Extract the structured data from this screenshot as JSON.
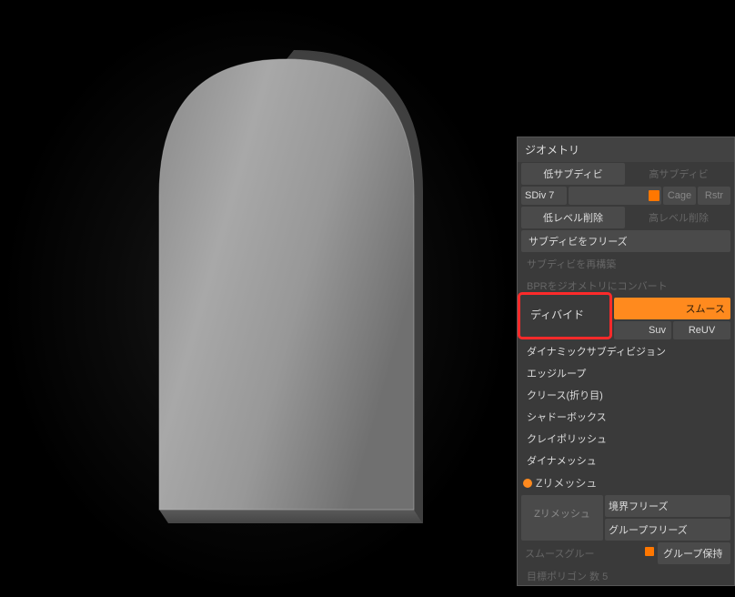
{
  "panel": {
    "title": "ジオメトリ",
    "low_subdiv": "低サブディビ",
    "high_subdiv": "高サブディビ",
    "sdiv_label": "SDiv 7",
    "cage": "Cage",
    "rstr": "Rstr",
    "del_low": "低レベル削除",
    "del_high": "高レベル削除",
    "freeze_subdiv": "サブディビをフリーズ",
    "reconstruct_subdiv": "サブディビを再構築",
    "bpr_convert": "BPRをジオメトリにコンバート",
    "divide": "ディバイド",
    "smooth": "スムース",
    "suv": "Suv",
    "reuv": "ReUV",
    "dynamic_subdiv": "ダイナミックサブディビジョン",
    "edgeloop": "エッジループ",
    "crease": "クリース(折り目)",
    "shadowbox": "シャドーボックス",
    "claypolish": "クレイポリッシュ",
    "dynamesh": "ダイナメッシュ",
    "zremesh_header": "Zリメッシュ",
    "zremesh_btn": "Zリメッシュ",
    "freeze_border": "境界フリーズ",
    "group_freeze": "グループフリーズ",
    "smooth_groups": "スムースグルー",
    "keep_groups": "グループ保持",
    "target_poly": "目標ポリゴン 数 5"
  }
}
